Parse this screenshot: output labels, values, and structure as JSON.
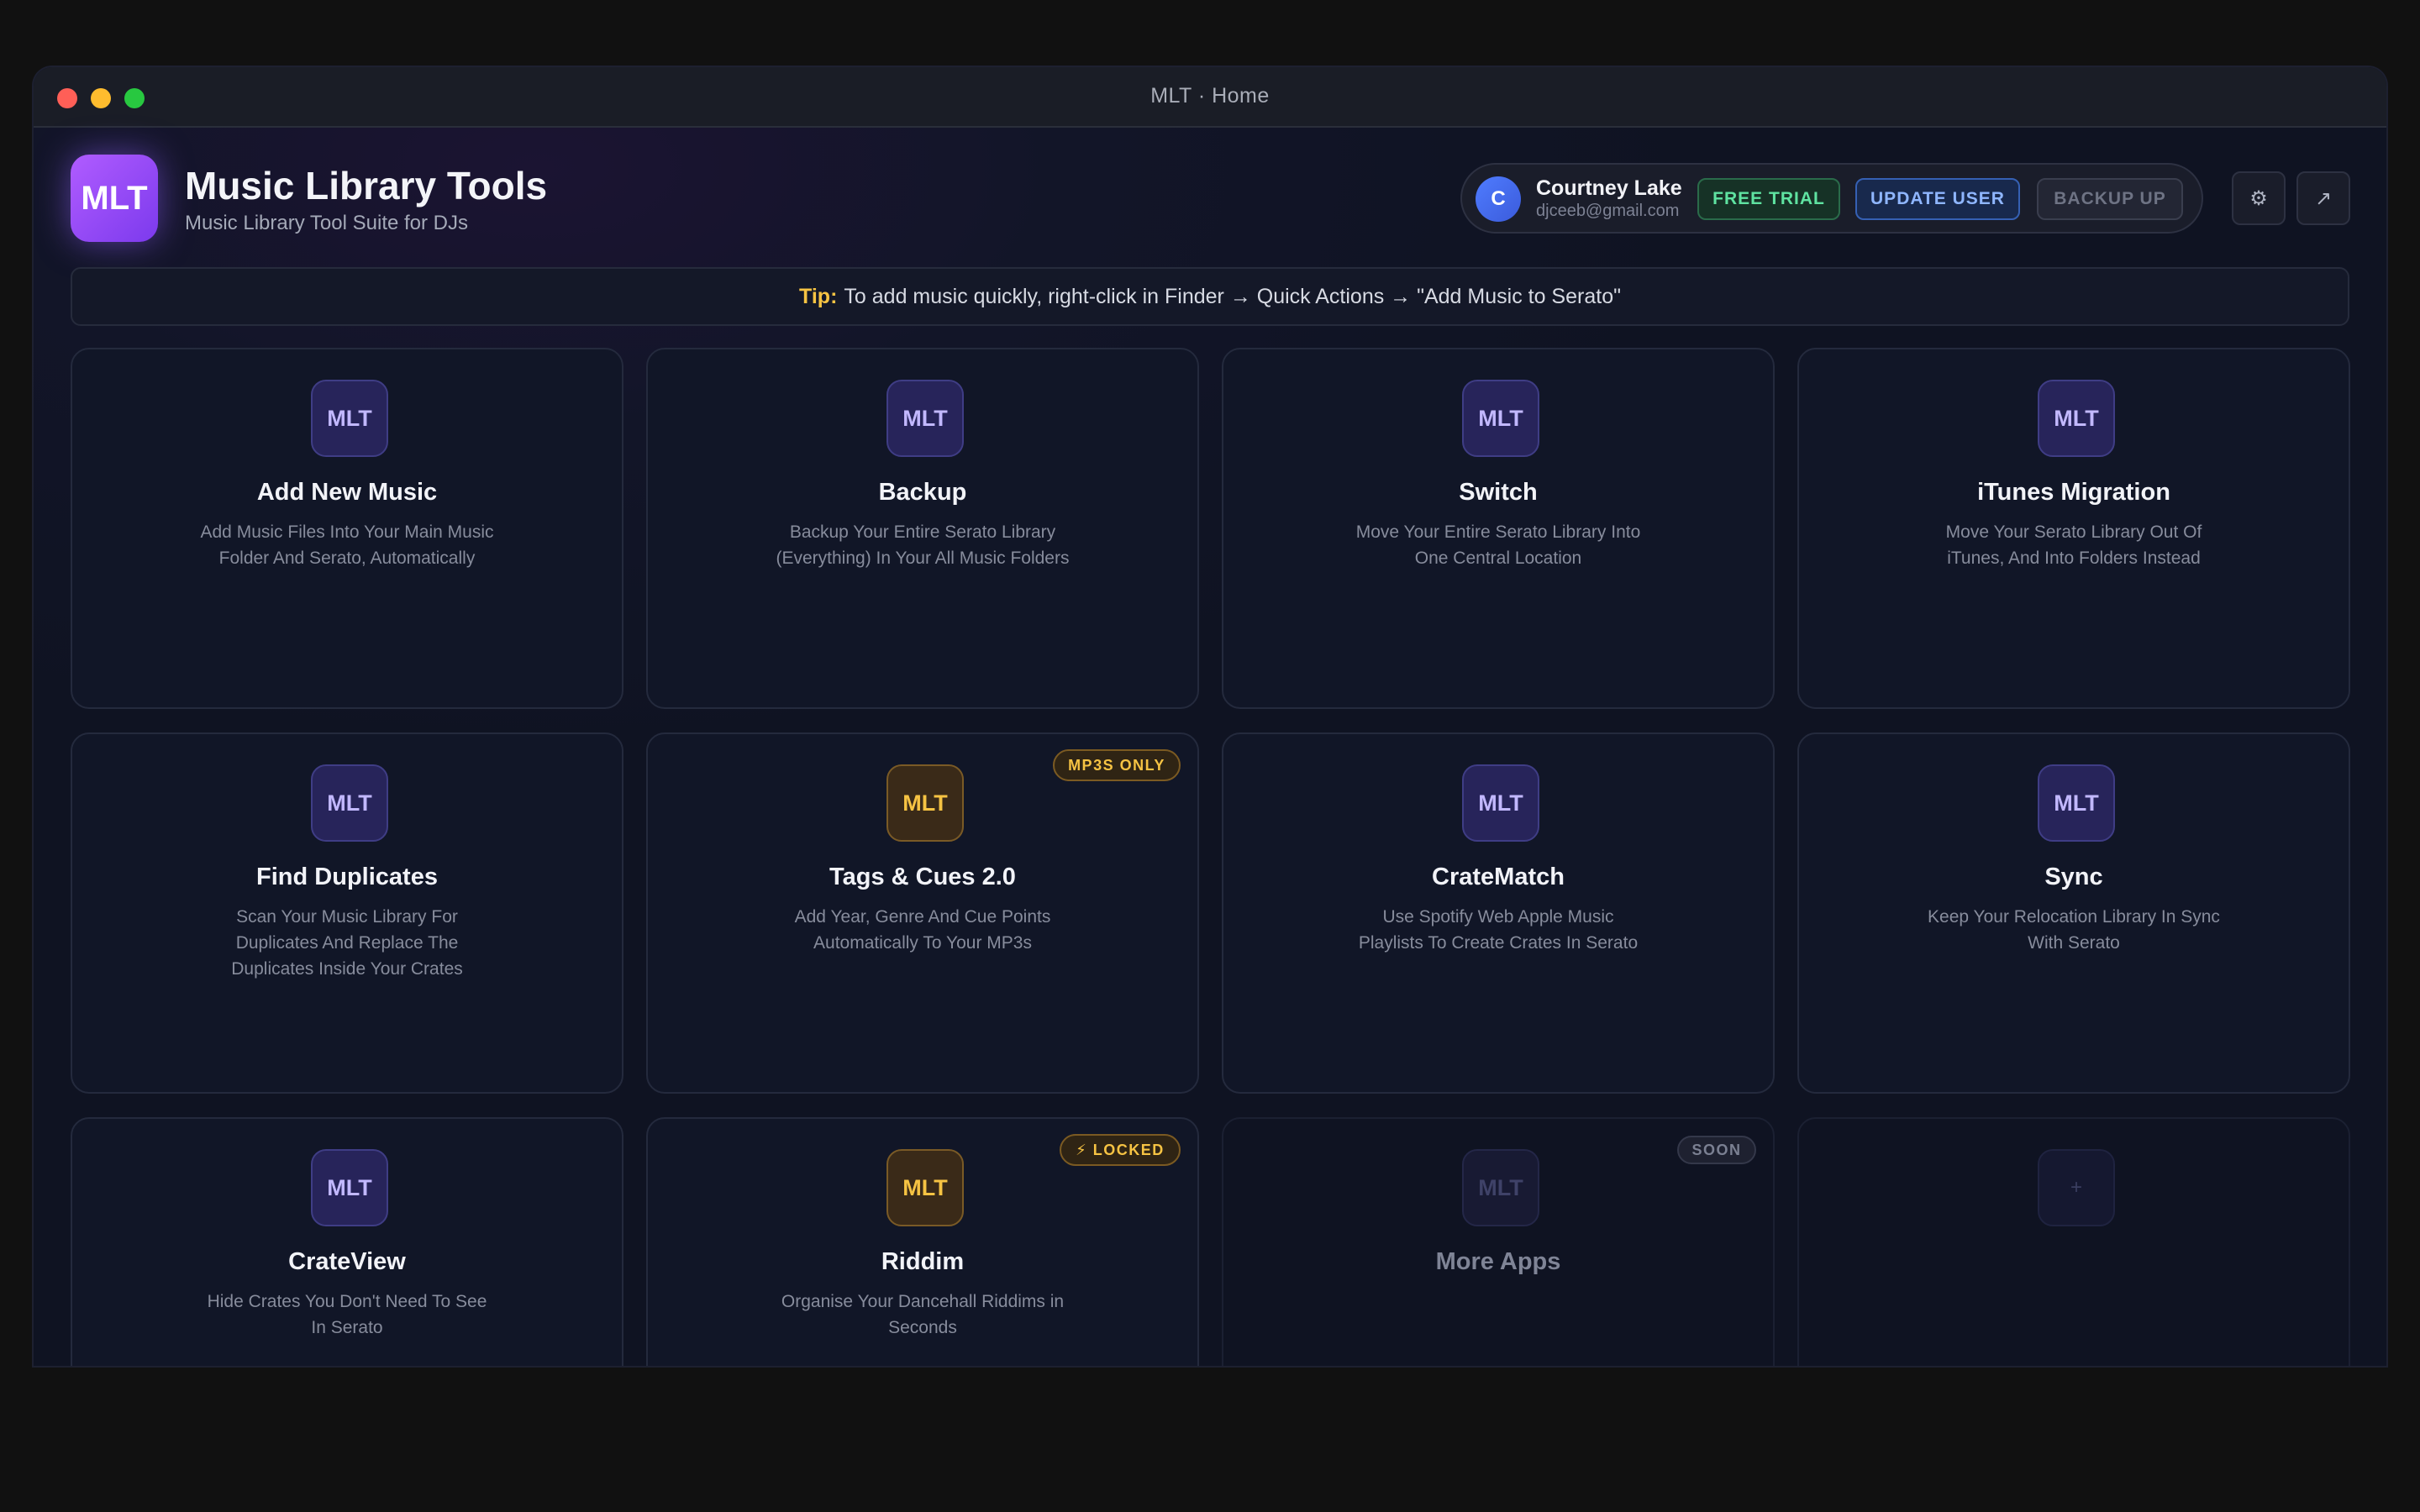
{
  "window": {
    "title": "MLT · Home"
  },
  "header": {
    "logo_text": "MLT",
    "title": "Music Library Tools",
    "subtitle": "Music Library Tool Suite for DJs"
  },
  "user": {
    "avatar_initial": "C",
    "name": "Courtney Lake",
    "email": "djceeb@gmail.com",
    "trial_label": "FREE TRIAL",
    "update_label": "UPDATE USER",
    "backup_label": "BACKUP UP"
  },
  "toolbar": {
    "settings_icon": "⚙",
    "open_icon": "↗"
  },
  "tip": {
    "label": "Tip:",
    "text": "To add music quickly, right-click in Finder → Quick Actions → \"Add Music to Serato\""
  },
  "cards": [
    {
      "icon": "MLT",
      "title": "Add New Music",
      "desc": "Add Music Files Into Your Main Music Folder And Serato, Automatically"
    },
    {
      "icon": "MLT",
      "title": "Backup",
      "desc": "Backup Your Entire Serato Library (Everything) In Your All Music Folders"
    },
    {
      "icon": "MLT",
      "title": "Switch",
      "desc": "Move Your Entire Serato Library Into One Central Location"
    },
    {
      "icon": "MLT",
      "title": "iTunes Migration",
      "desc": "Move Your Serato Library Out Of iTunes, And Into Folders Instead"
    },
    {
      "icon": "MLT",
      "title": "Find Duplicates",
      "desc": "Scan Your Music Library For Duplicates And Replace The Duplicates Inside Your Crates"
    },
    {
      "icon": "MLT",
      "title": "Tags & Cues 2.0",
      "desc": "Add Year, Genre And Cue Points Automatically To Your MP3s",
      "badge": "MP3S ONLY"
    },
    {
      "icon": "MLT",
      "title": "CrateMatch",
      "desc": "Use Spotify Web Apple Music Playlists To Create Crates In Serato"
    },
    {
      "icon": "MLT",
      "title": "Sync",
      "desc": "Keep Your Relocation Library In Sync With Serato"
    },
    {
      "icon": "MLT",
      "title": "CrateView",
      "desc": "Hide Crates You Don't Need To See In Serato"
    },
    {
      "icon": "MLT",
      "title": "Riddim",
      "desc": "Organise Your Dancehall Riddims in Seconds",
      "badge": "⚡ LOCKED"
    },
    {
      "icon": "MLT",
      "title": "More Apps",
      "badge": "SOON"
    },
    {
      "icon": "+"
    }
  ],
  "colors": {
    "accent_purple": "#8b5cf6",
    "tip_yellow": "#f6c343",
    "trial_green": "#5fe3a1",
    "update_blue": "#8fb6ff"
  }
}
